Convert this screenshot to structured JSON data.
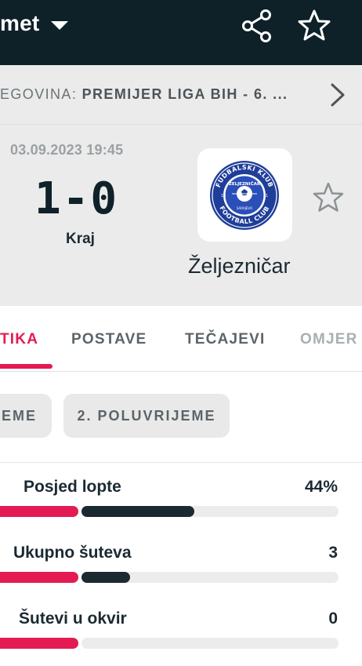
{
  "header": {
    "title": "met",
    "share_icon": "share-icon",
    "favorite_icon": "star-outline-icon"
  },
  "league": {
    "country": "EGOVINA: ",
    "name": "PREMIJER LIGA BIH - 6. ..."
  },
  "match": {
    "datetime": "03.09.2023 19:45",
    "score": "1-0",
    "status": "Kraj",
    "team_right": "Željezničar",
    "logo": {
      "top_text": "FUDBALSKI KLUB",
      "bottom_text": "FOOTBALL CLUB",
      "inner_text": "ŽELJEZNIČAR",
      "city": "SARAJEVO",
      "year_left": "19",
      "year_right": "21"
    }
  },
  "tabs": [
    {
      "label": "TIKA",
      "active": true
    },
    {
      "label": "POSTAVE",
      "active": false
    },
    {
      "label": "TEČAJEVI",
      "active": false
    },
    {
      "label": "OMJER",
      "active": false
    }
  ],
  "periods": [
    {
      "label": "EME"
    },
    {
      "label": "2. POLUVRIJEME"
    }
  ],
  "stats": [
    {
      "label": "Posjed lopte",
      "value": "44%",
      "away_fraction": 0.44
    },
    {
      "label": "Ukupno šuteva",
      "value": "3",
      "away_fraction": 0.19
    },
    {
      "label": "Šutevi u okvir",
      "value": "0",
      "away_fraction": 0.0
    }
  ],
  "colors": {
    "topbar": "#0e2129",
    "accent": "#e41b52",
    "dark": "#1b2a31",
    "panel": "#ebebeb"
  }
}
